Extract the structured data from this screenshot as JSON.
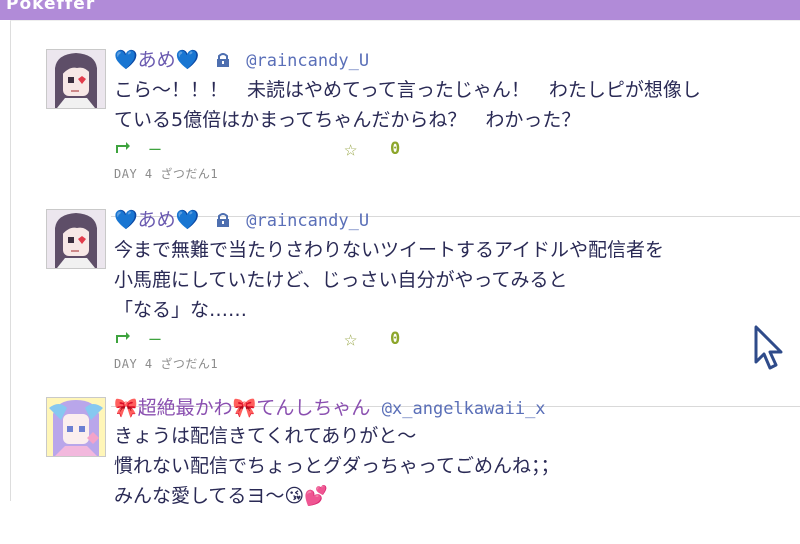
{
  "app": {
    "title": "Pokeffer"
  },
  "posts": [
    {
      "name": "💙あめ💙",
      "handle": "@raincandy_U",
      "lines": [
        "こら～！！！　未読はやめてって言ったじゃん！　わたしピが想像し",
        "ている5億倍はかまってちゃんだからね？　わかった？"
      ],
      "retweet_count": "ー",
      "fav_count": "0",
      "meta": "DAY 4 ざつだん1"
    },
    {
      "name": "💙あめ💙",
      "handle": "@raincandy_U",
      "lines": [
        "今まで無難で当たりさわりないツイートするアイドルや配信者を",
        "小馬鹿にしていたけど、じっさい自分がやってみると",
        "「なる」な……"
      ],
      "retweet_count": "ー",
      "fav_count": "0",
      "meta": "DAY 4 ざつだん1"
    },
    {
      "name": "🎀超絶最かわ🎀てんしちゃん",
      "handle": "@x_angelkawaii_x",
      "lines": [
        "きょうは配信きてくれてありがと～",
        "慣れない配信でちょっとグダっちゃってごめんね；；",
        "みんな愛してるヨ～😘💕"
      ],
      "retweet_count": "",
      "fav_count": "",
      "meta": ""
    }
  ],
  "colors": {
    "titlebar": "#b18bd8",
    "name": "#6a5ab0",
    "handle": "#5a6fb8",
    "body": "#2a2a55",
    "retweet": "#3ea33e",
    "star": "#9aa84b"
  }
}
